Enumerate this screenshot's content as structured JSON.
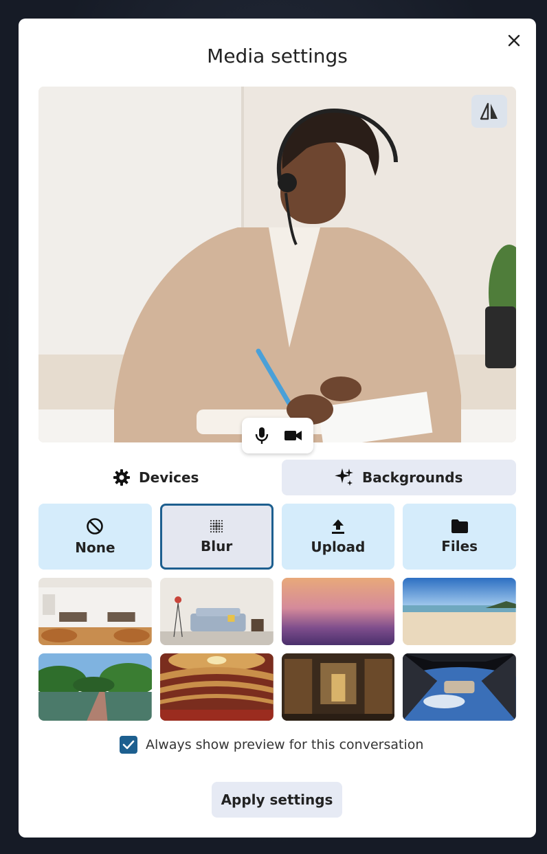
{
  "dialog": {
    "title": "Media settings",
    "close_icon": "close-icon"
  },
  "preview": {
    "mirror_icon": "mirror-icon",
    "controls": {
      "mic_icon": "microphone-icon",
      "camera_icon": "video-camera-icon"
    }
  },
  "tabs": [
    {
      "label": "Devices",
      "icon": "gear-icon",
      "active": false
    },
    {
      "label": "Backgrounds",
      "icon": "sparkles-icon",
      "active": true
    }
  ],
  "background_options": [
    {
      "label": "None",
      "icon": "block-icon"
    },
    {
      "label": "Blur",
      "icon": "blur-icon",
      "selected": true
    },
    {
      "label": "Upload",
      "icon": "upload-icon"
    },
    {
      "label": "Files",
      "icon": "folder-icon"
    }
  ],
  "thumbnails": [
    "office-room",
    "living-room",
    "sunset-gradient",
    "beach",
    "river-jungle",
    "opera-theater",
    "library-hall",
    "space-station"
  ],
  "preview_option": {
    "label": "Always show preview for this conversation",
    "checked": true
  },
  "apply_button": {
    "label": "Apply settings"
  },
  "colors": {
    "accent": "#1d5f8f",
    "option_bg": "#d5ecfb",
    "tab_active_bg": "#e6eaf4"
  }
}
